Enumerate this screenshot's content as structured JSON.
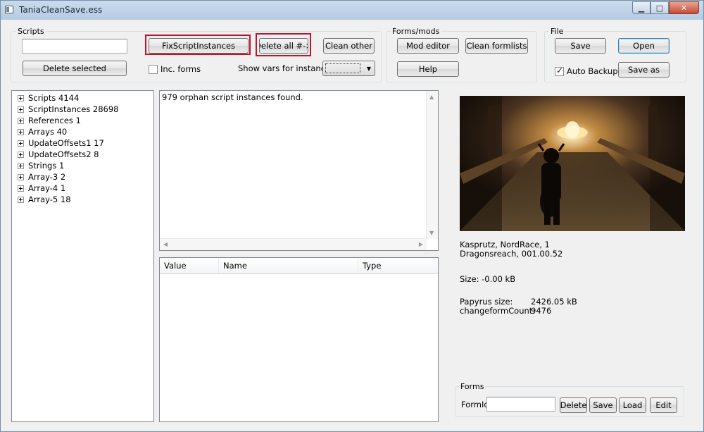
{
  "window": {
    "title": "TaniaCleanSave.ess"
  },
  "scripts_group": {
    "label": "Scripts",
    "search_value": "",
    "fix_button": "FixScriptInstances",
    "delete_all_button": "Delete all #->",
    "clean_other_button": "Clean other",
    "delete_selected_button": "Delete selected",
    "inc_forms_label": "Inc. forms",
    "inc_forms_checked": false,
    "show_vars_label": "Show vars for instance",
    "instance_select_value": ""
  },
  "forms_mods_group": {
    "label": "Forms/mods",
    "mod_editor_button": "Mod editor",
    "clean_formlists_button": "Clean formlists",
    "help_button": "Help"
  },
  "file_group": {
    "label": "File",
    "save_button": "Save",
    "open_button": "Open",
    "auto_backup_label": "Auto Backup",
    "auto_backup_checked": true,
    "save_as_button": "Save as"
  },
  "tree": {
    "items": [
      {
        "label": "Scripts 4144"
      },
      {
        "label": "ScriptInstances 28698"
      },
      {
        "label": "References 1"
      },
      {
        "label": "Arrays 40"
      },
      {
        "label": "UpdateOffsets1 17"
      },
      {
        "label": "UpdateOffsets2 8"
      },
      {
        "label": "Strings 1"
      },
      {
        "label": "Array-3 2"
      },
      {
        "label": "Array-4 1"
      },
      {
        "label": "Array-5 18"
      }
    ]
  },
  "log": {
    "text": "979 orphan script instances found."
  },
  "vars_table": {
    "columns": [
      "Value",
      "Name",
      "Type"
    ],
    "rows": []
  },
  "character": {
    "line1": "Kasprutz, NordRace, 1",
    "line2": "Dragonsreach, 001.00.52",
    "size": "Size: -0.00 kB",
    "papyrus_label": "Papyrus size:",
    "papyrus_value": "2426.05 kB",
    "changeform_label": "changeformCount:",
    "changeform_value": "9476"
  },
  "forms_group": {
    "label": "Forms",
    "formid_label": "FormId",
    "formid_value": "",
    "delete_button": "Delete",
    "save_button": "Save",
    "load_button": "Load",
    "edit_button": "Edit"
  },
  "icons": {
    "tree_expand": "plus-box-icon",
    "dropdown": "chevron-down-icon"
  },
  "colors": {
    "highlight": "#c0142d",
    "titlebar": "#c9dbee",
    "close_button": "#c74a35"
  }
}
